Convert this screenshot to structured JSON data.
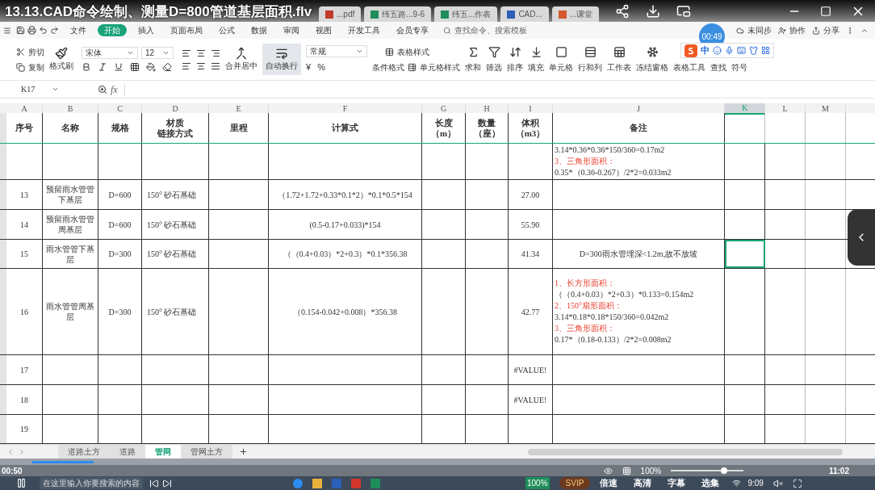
{
  "video": {
    "title": "13.13.CAD命令绘制、测量D=800管道基层面积.flv",
    "timer": "00:49",
    "current_time": "00:50",
    "duration": "11:02",
    "level": 0.075,
    "badge": "SVIP",
    "controls": [
      "倍速",
      "高清",
      "字幕",
      "选集"
    ]
  },
  "browser_tabs": [
    {
      "label": "...pdf",
      "kind": "pdf"
    },
    {
      "label": "纬五路...9-6",
      "kind": "sheet"
    },
    {
      "label": "纬五...作表",
      "kind": "sheet"
    },
    {
      "label": "CAD...",
      "kind": "doc"
    },
    {
      "label": "...课堂",
      "kind": "ppt"
    }
  ],
  "menu": [
    {
      "label": "文件",
      "selected": false
    },
    {
      "label": "开始",
      "selected": true
    },
    {
      "label": "插入",
      "selected": false
    },
    {
      "label": "页面布局",
      "selected": false
    },
    {
      "label": "公式",
      "selected": false
    },
    {
      "label": "数据",
      "selected": false
    },
    {
      "label": "审阅",
      "selected": false
    },
    {
      "label": "视图",
      "selected": false
    },
    {
      "label": "开发工具",
      "selected": false
    },
    {
      "label": "会员专享",
      "selected": false
    }
  ],
  "search": {
    "placeholder": "查找命令、搜索模板"
  },
  "account_actions": [
    "未同步",
    "协作",
    "分享"
  ],
  "ribbon": {
    "clipboard": [
      "剪切",
      "复制",
      "格式刷"
    ],
    "font_family": "宋体",
    "font_size": "12",
    "merge": "合并居中",
    "wrap": {
      "label": "自动换行",
      "on": true
    },
    "number_format": "常规",
    "number_symbols": [
      "¥",
      "%"
    ],
    "styles": [
      "表格样式",
      "条件格式",
      "单元格样式"
    ],
    "tools": [
      "求和",
      "筛选",
      "排序",
      "填充",
      "单元格",
      "行和列",
      "工作表",
      "冻结窗格",
      "表格工具",
      "查找",
      "符号"
    ],
    "ime": "中"
  },
  "formula_bar": {
    "cell": "K17",
    "fx": "fx"
  },
  "sheet": {
    "columns": [
      {
        "label": "A",
        "selected": false
      },
      {
        "label": "B",
        "selected": false
      },
      {
        "label": "C",
        "selected": false
      },
      {
        "label": "D",
        "selected": false
      },
      {
        "label": "E",
        "selected": false
      },
      {
        "label": "F",
        "selected": false
      },
      {
        "label": "G",
        "selected": false
      },
      {
        "label": "H",
        "selected": false
      },
      {
        "label": "I",
        "selected": false
      },
      {
        "label": "J",
        "selected": false
      },
      {
        "label": "K",
        "selected": true
      },
      {
        "label": "L",
        "selected": false
      },
      {
        "label": "M",
        "selected": false
      }
    ],
    "header": [
      [
        "序号"
      ],
      [
        "名称"
      ],
      [
        "规格"
      ],
      [
        "材质",
        "链接方式"
      ],
      [
        "里程"
      ],
      [
        "计算式"
      ],
      [
        "长度",
        "（m）"
      ],
      [
        "数量",
        "（座）"
      ],
      [
        "体积",
        "（m3）"
      ],
      [
        "备注"
      ]
    ],
    "rows": [
      {
        "cells": [
          "",
          "",
          "",
          "",
          "",
          "",
          "",
          "",
          "",
          ""
        ],
        "notes": [
          {
            "text": "3.14*0.36*0.36*150/360=0.17m2",
            "kind": "plain"
          },
          {
            "text": "3、三角形面积：",
            "kind": "heading"
          },
          {
            "text": "0.35*（0.36-0.267）/2*2=0.033m2",
            "kind": "plain"
          }
        ],
        "selected": false
      },
      {
        "cells": [
          "13",
          "预留雨水管管下基层",
          "D=600",
          "150° 砂石基础",
          "",
          "（1.72+1.72+0.33*0.1*2）*0.1*0.5*154",
          "",
          "",
          "27.00",
          ""
        ],
        "notes": [],
        "selected": false
      },
      {
        "cells": [
          "14",
          "预留雨水管管周基层",
          "D=600",
          "150° 砂石基础",
          "",
          "(0.5-0.17+0.033)*154",
          "",
          "",
          "55.90",
          ""
        ],
        "notes": [],
        "selected": false
      },
      {
        "cells": [
          "15",
          "雨水管管下基层",
          "D=300",
          "150° 砂石基础",
          "",
          "（（0.4+0.03）*2+0.3）*0.1*356.38",
          "",
          "",
          "41.34",
          "D=300雨水管埋深<1.2m,故不放坡"
        ],
        "notes": [],
        "selected": true
      },
      {
        "cells": [
          "16",
          "雨水管管周基层",
          "D=300",
          "150° 砂石基础",
          "",
          "（0.154-0.042+0.008）*356.38",
          "",
          "",
          "42.77",
          ""
        ],
        "notes": [
          {
            "text": "1、长方形面积：",
            "kind": "heading"
          },
          {
            "text": "（（0.4+0.03）*2+0.3）*0.133=0.154m2",
            "kind": "plain"
          },
          {
            "text": "2、150°扇形面积：",
            "kind": "heading"
          },
          {
            "text": "3.14*0.18*0.18*150/360=0.042m2",
            "kind": "plain"
          },
          {
            "text": "3、三角形面积：",
            "kind": "heading"
          },
          {
            "text": "0.17*（0.18-0.133）/2*2=0.008m2",
            "kind": "plain"
          }
        ],
        "selected": false
      },
      {
        "cells": [
          "17",
          "",
          "",
          "",
          "",
          "",
          "",
          "",
          "#VALUE!",
          ""
        ],
        "notes": [],
        "selected": false
      },
      {
        "cells": [
          "18",
          "",
          "",
          "",
          "",
          "",
          "",
          "",
          "#VALUE!",
          ""
        ],
        "notes": [],
        "selected": false
      },
      {
        "cells": [
          "19",
          "",
          "",
          "",
          "",
          "",
          "",
          "",
          "",
          ""
        ],
        "notes": [],
        "selected": false
      }
    ]
  },
  "sheet_tabs": [
    {
      "label": "道路土方",
      "selected": false
    },
    {
      "label": "道路",
      "selected": false
    },
    {
      "label": "管网",
      "selected": true
    },
    {
      "label": "管网土方",
      "selected": false
    }
  ],
  "status": {
    "zoom": "100%",
    "level": 0.75
  },
  "taskbar": {
    "search_placeholder": "在这里输入你要搜索的内容",
    "battery": "100%",
    "time": "9:09"
  }
}
